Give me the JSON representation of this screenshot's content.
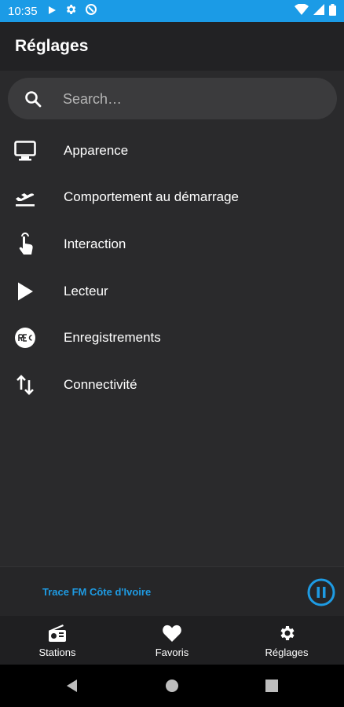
{
  "status_bar": {
    "time": "10:35",
    "icons": [
      "play-icon",
      "gear-icon",
      "data-saver-icon"
    ],
    "right_icons": [
      "wifi-icon",
      "signal-icon",
      "battery-icon"
    ]
  },
  "app_bar": {
    "title": "Réglages"
  },
  "search": {
    "placeholder": "Search…",
    "value": ""
  },
  "menu": {
    "items": [
      {
        "label": "Apparence",
        "icon": "monitor-icon"
      },
      {
        "label": "Comportement au démarrage",
        "icon": "airplane-takeoff-icon"
      },
      {
        "label": "Interaction",
        "icon": "touch-hand-icon"
      },
      {
        "label": "Lecteur",
        "icon": "play-icon"
      },
      {
        "label": "Enregistrements",
        "icon": "rec-icon"
      },
      {
        "label": "Connectivité",
        "icon": "swap-vertical-icon"
      }
    ]
  },
  "mini_player": {
    "station": "Trace FM Côte d'Ivoire",
    "accent": "#1e9be3"
  },
  "bottom_nav": {
    "tabs": [
      {
        "label": "Stations",
        "icon": "radio-icon"
      },
      {
        "label": "Favoris",
        "icon": "heart-icon"
      },
      {
        "label": "Réglages",
        "icon": "gear-icon"
      }
    ]
  },
  "colors": {
    "status_bar": "#1b9be6",
    "background": "#2a2a2c",
    "accent": "#1e9be3"
  }
}
